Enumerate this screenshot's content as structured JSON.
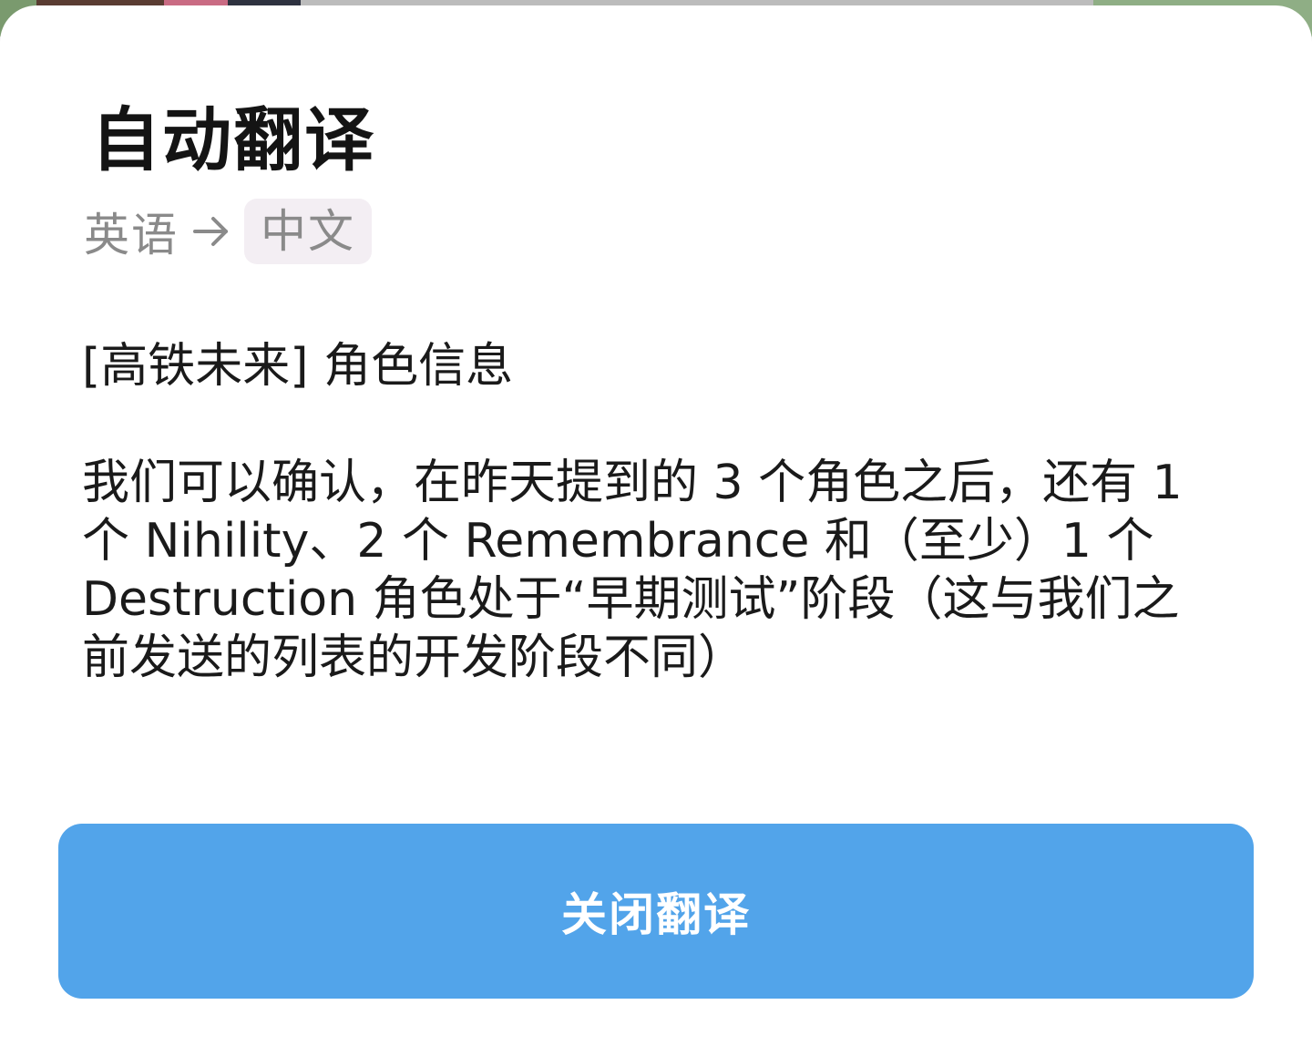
{
  "dialog": {
    "title": "自动翻译",
    "source_language": "英语",
    "target_language": "中文",
    "arrow_icon": "arrow-right-icon",
    "translated_text": "[高铁未来] 角色信息\n\n我们可以确认，在昨天提到的 3 个角色之后，还有 1 个 Nihility、2 个 Remembrance 和（至少）1 个 Destruction 角色处于“早期测试”阶段（这与我们之前发送的列表的开发阶段不同）",
    "close_button_label": "关闭翻译"
  },
  "colors": {
    "button_bg": "#52a4ea",
    "target_chip_bg": "#f3eef3",
    "muted_text": "#8a8a8a"
  }
}
